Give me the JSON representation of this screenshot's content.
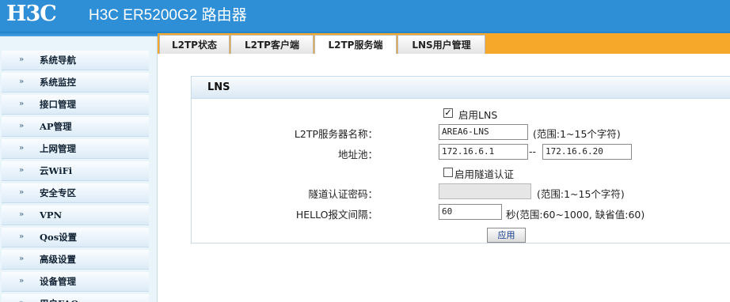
{
  "header": {
    "logo": "H3C",
    "title": "H3C ER5200G2 路由器"
  },
  "sidebar": {
    "items": [
      {
        "label": "系统导航"
      },
      {
        "label": "系统监控"
      },
      {
        "label": "接口管理"
      },
      {
        "label": "AP管理"
      },
      {
        "label": "上网管理"
      },
      {
        "label": "云WiFi"
      },
      {
        "label": "安全专区"
      },
      {
        "label": "VPN"
      },
      {
        "label": "Qos设置"
      },
      {
        "label": "高级设置"
      },
      {
        "label": "设备管理"
      },
      {
        "label": "用户FAQ"
      }
    ],
    "arrow_icon": "double-chevron-right-icon"
  },
  "tabs": [
    {
      "label": "L2TP状态"
    },
    {
      "label": "L2TP客户端"
    },
    {
      "label": "L2TP服务端",
      "active": true
    },
    {
      "label": "LNS用户管理"
    }
  ],
  "panel": {
    "title": "LNS",
    "enable_lns": {
      "label": "启用LNS",
      "checked": true
    },
    "server_name": {
      "label": "L2TP服务器名称：",
      "value": "AREA6-LNS",
      "hint": "(范围:1~15个字符)"
    },
    "address_pool": {
      "label": "地址池：",
      "start": "172.16.6.1",
      "separator": "--",
      "end": "172.16.6.20"
    },
    "tunnel_auth": {
      "label": "启用隧道认证",
      "checked": false
    },
    "tunnel_password": {
      "label": "隧道认证密码：",
      "value": "",
      "hint": "(范围:1~15个字符)"
    },
    "hello_interval": {
      "label": "HELLO报文间隔：",
      "value": "60",
      "hint": "秒(范围:60~1000, 缺省值:60)"
    },
    "apply_label": "应用"
  },
  "colors": {
    "header_blue": "#2f8fd6",
    "tab_strip_orange": "#f5a82a",
    "sidebar_bg": "#eaf4fb"
  }
}
